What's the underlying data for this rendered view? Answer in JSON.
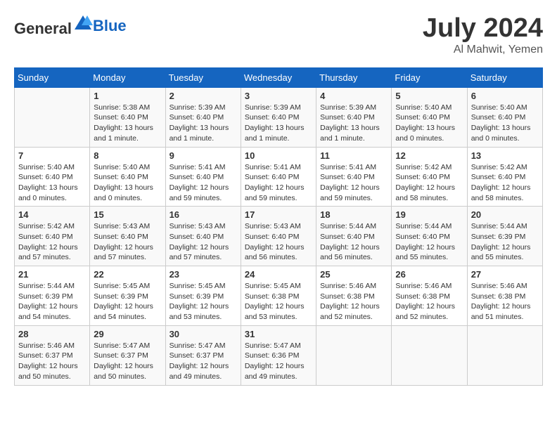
{
  "header": {
    "logo_general": "General",
    "logo_blue": "Blue",
    "month_year": "July 2024",
    "location": "Al Mahwit, Yemen"
  },
  "days_of_week": [
    "Sunday",
    "Monday",
    "Tuesday",
    "Wednesday",
    "Thursday",
    "Friday",
    "Saturday"
  ],
  "weeks": [
    [
      {
        "day": "",
        "info": ""
      },
      {
        "day": "1",
        "info": "Sunrise: 5:38 AM\nSunset: 6:40 PM\nDaylight: 13 hours\nand 1 minute."
      },
      {
        "day": "2",
        "info": "Sunrise: 5:39 AM\nSunset: 6:40 PM\nDaylight: 13 hours\nand 1 minute."
      },
      {
        "day": "3",
        "info": "Sunrise: 5:39 AM\nSunset: 6:40 PM\nDaylight: 13 hours\nand 1 minute."
      },
      {
        "day": "4",
        "info": "Sunrise: 5:39 AM\nSunset: 6:40 PM\nDaylight: 13 hours\nand 1 minute."
      },
      {
        "day": "5",
        "info": "Sunrise: 5:40 AM\nSunset: 6:40 PM\nDaylight: 13 hours\nand 0 minutes."
      },
      {
        "day": "6",
        "info": "Sunrise: 5:40 AM\nSunset: 6:40 PM\nDaylight: 13 hours\nand 0 minutes."
      }
    ],
    [
      {
        "day": "7",
        "info": "Sunrise: 5:40 AM\nSunset: 6:40 PM\nDaylight: 13 hours\nand 0 minutes."
      },
      {
        "day": "8",
        "info": "Sunrise: 5:40 AM\nSunset: 6:40 PM\nDaylight: 13 hours\nand 0 minutes."
      },
      {
        "day": "9",
        "info": "Sunrise: 5:41 AM\nSunset: 6:40 PM\nDaylight: 12 hours\nand 59 minutes."
      },
      {
        "day": "10",
        "info": "Sunrise: 5:41 AM\nSunset: 6:40 PM\nDaylight: 12 hours\nand 59 minutes."
      },
      {
        "day": "11",
        "info": "Sunrise: 5:41 AM\nSunset: 6:40 PM\nDaylight: 12 hours\nand 59 minutes."
      },
      {
        "day": "12",
        "info": "Sunrise: 5:42 AM\nSunset: 6:40 PM\nDaylight: 12 hours\nand 58 minutes."
      },
      {
        "day": "13",
        "info": "Sunrise: 5:42 AM\nSunset: 6:40 PM\nDaylight: 12 hours\nand 58 minutes."
      }
    ],
    [
      {
        "day": "14",
        "info": "Sunrise: 5:42 AM\nSunset: 6:40 PM\nDaylight: 12 hours\nand 57 minutes."
      },
      {
        "day": "15",
        "info": "Sunrise: 5:43 AM\nSunset: 6:40 PM\nDaylight: 12 hours\nand 57 minutes."
      },
      {
        "day": "16",
        "info": "Sunrise: 5:43 AM\nSunset: 6:40 PM\nDaylight: 12 hours\nand 57 minutes."
      },
      {
        "day": "17",
        "info": "Sunrise: 5:43 AM\nSunset: 6:40 PM\nDaylight: 12 hours\nand 56 minutes."
      },
      {
        "day": "18",
        "info": "Sunrise: 5:44 AM\nSunset: 6:40 PM\nDaylight: 12 hours\nand 56 minutes."
      },
      {
        "day": "19",
        "info": "Sunrise: 5:44 AM\nSunset: 6:40 PM\nDaylight: 12 hours\nand 55 minutes."
      },
      {
        "day": "20",
        "info": "Sunrise: 5:44 AM\nSunset: 6:39 PM\nDaylight: 12 hours\nand 55 minutes."
      }
    ],
    [
      {
        "day": "21",
        "info": "Sunrise: 5:44 AM\nSunset: 6:39 PM\nDaylight: 12 hours\nand 54 minutes."
      },
      {
        "day": "22",
        "info": "Sunrise: 5:45 AM\nSunset: 6:39 PM\nDaylight: 12 hours\nand 54 minutes."
      },
      {
        "day": "23",
        "info": "Sunrise: 5:45 AM\nSunset: 6:39 PM\nDaylight: 12 hours\nand 53 minutes."
      },
      {
        "day": "24",
        "info": "Sunrise: 5:45 AM\nSunset: 6:38 PM\nDaylight: 12 hours\nand 53 minutes."
      },
      {
        "day": "25",
        "info": "Sunrise: 5:46 AM\nSunset: 6:38 PM\nDaylight: 12 hours\nand 52 minutes."
      },
      {
        "day": "26",
        "info": "Sunrise: 5:46 AM\nSunset: 6:38 PM\nDaylight: 12 hours\nand 52 minutes."
      },
      {
        "day": "27",
        "info": "Sunrise: 5:46 AM\nSunset: 6:38 PM\nDaylight: 12 hours\nand 51 minutes."
      }
    ],
    [
      {
        "day": "28",
        "info": "Sunrise: 5:46 AM\nSunset: 6:37 PM\nDaylight: 12 hours\nand 50 minutes."
      },
      {
        "day": "29",
        "info": "Sunrise: 5:47 AM\nSunset: 6:37 PM\nDaylight: 12 hours\nand 50 minutes."
      },
      {
        "day": "30",
        "info": "Sunrise: 5:47 AM\nSunset: 6:37 PM\nDaylight: 12 hours\nand 49 minutes."
      },
      {
        "day": "31",
        "info": "Sunrise: 5:47 AM\nSunset: 6:36 PM\nDaylight: 12 hours\nand 49 minutes."
      },
      {
        "day": "",
        "info": ""
      },
      {
        "day": "",
        "info": ""
      },
      {
        "day": "",
        "info": ""
      }
    ]
  ]
}
